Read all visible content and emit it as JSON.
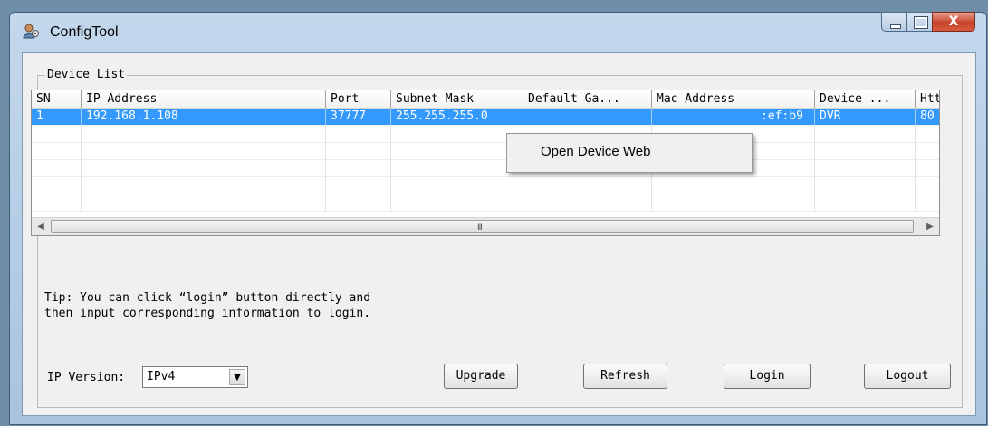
{
  "window": {
    "title": "ConfigTool",
    "close_glyph": "X",
    "icons": [
      "app-icon",
      "minimize-icon",
      "maximize-icon",
      "close-icon"
    ]
  },
  "group": {
    "label": "Device List"
  },
  "table": {
    "columns": [
      "SN",
      "IP Address",
      "Port",
      "Subnet Mask",
      "Default Ga...",
      "Mac Address",
      "Device ...",
      "Http"
    ],
    "rows": [
      [
        "1",
        "192.168.1.108",
        "37777",
        "255.255.255.0",
        "",
        ":ef:b9",
        "DVR",
        "80"
      ]
    ],
    "selected_row": 0,
    "scroll_grip": "III"
  },
  "context_menu": {
    "items": [
      "Open Device Web"
    ]
  },
  "tip": {
    "line1": "Tip: You can click “login” button directly and",
    "line2": "then input corresponding information to login."
  },
  "ip_version": {
    "label": "IP Version:",
    "value": "IPv4"
  },
  "buttons": {
    "upgrade": "Upgrade",
    "refresh": "Refresh",
    "login": "Login",
    "logout": "Logout"
  },
  "colors": {
    "selection": "#3399ff",
    "title_bar": "#b7cfe7",
    "close_button": "#c7432a"
  }
}
